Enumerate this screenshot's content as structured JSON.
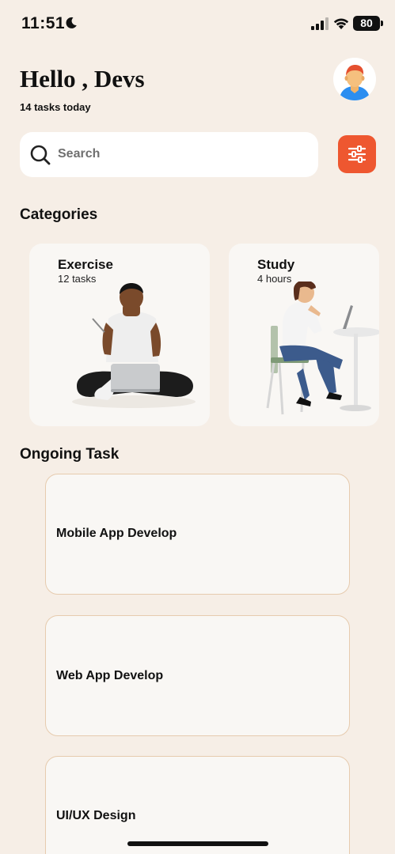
{
  "status_bar": {
    "time": "11:51",
    "battery": "80"
  },
  "header": {
    "greeting": "Hello , Devs",
    "subtitle": "14 tasks today"
  },
  "search": {
    "placeholder": "Search",
    "value": ""
  },
  "categories": {
    "title": "Categories",
    "items": [
      {
        "name": "Exercise",
        "meta": "12 tasks"
      },
      {
        "name": "Study",
        "meta": "4 hours"
      }
    ]
  },
  "ongoing": {
    "title": "Ongoing Task",
    "items": [
      {
        "title": "Mobile App Develop"
      },
      {
        "title": "Web App Develop"
      },
      {
        "title": "UI/UX Design"
      }
    ]
  },
  "colors": {
    "background": "#F6EEE6",
    "accent": "#EE5730",
    "card": "#F9F7F4",
    "card_border": "#E6CBAE"
  }
}
